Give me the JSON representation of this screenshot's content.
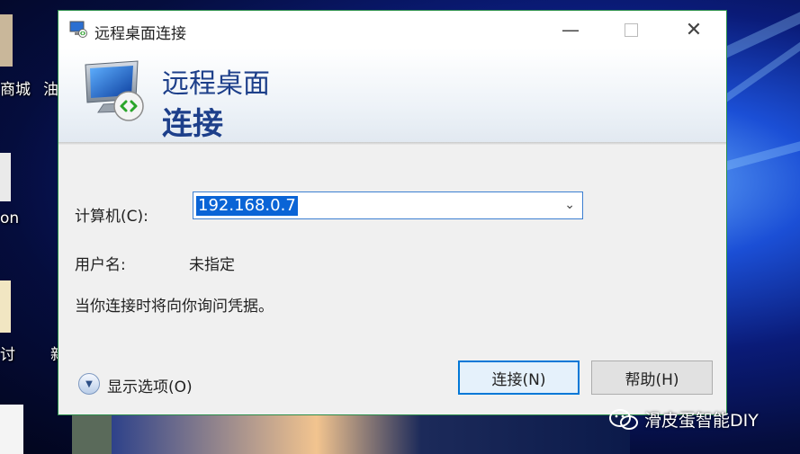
{
  "desktop": {
    "icon_labels": [
      "商城",
      "油",
      "on",
      "讨",
      "新"
    ]
  },
  "dialog": {
    "title": "远程桌面连接",
    "banner": {
      "line1": "远程桌面",
      "line2": "连接"
    },
    "computer": {
      "label": "计算机(C):",
      "value": "192.168.0.7"
    },
    "username": {
      "label": "用户名:",
      "value": "未指定"
    },
    "info_text": "当你连接时将向你询问凭据。",
    "show_options": "显示选项(O)",
    "connect_button": "连接(N)",
    "help_button": "帮助(H)"
  },
  "watermark": {
    "text": "滑皮蛋智能DIY"
  },
  "colors": {
    "accent": "#0078d7",
    "banner_text": "#1d3f8a",
    "selection": "#0a64d6"
  }
}
